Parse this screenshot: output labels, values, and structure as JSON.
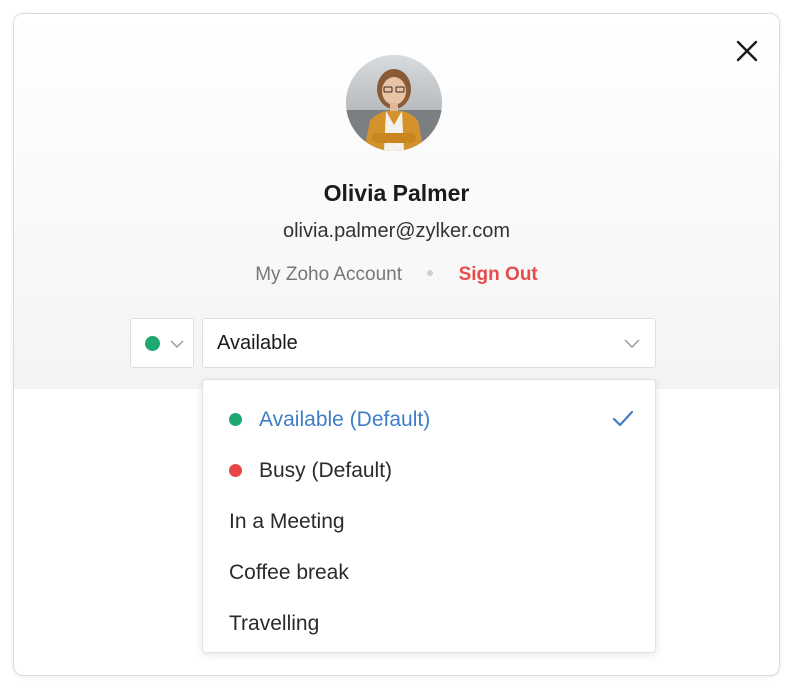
{
  "profile": {
    "name": "Olivia Palmer",
    "email": "olivia.palmer@zylker.com",
    "my_account_label": "My Zoho Account",
    "sign_out_label": "Sign Out"
  },
  "status": {
    "selected_value": "Available",
    "current_dot_color": "#1fa971",
    "options": [
      {
        "label": "Available (Default)",
        "dot_color": "#1fa971",
        "selected": true
      },
      {
        "label": "Busy (Default)",
        "dot_color": "#e84545",
        "selected": false
      },
      {
        "label": "In a Meeting",
        "dot_color": null,
        "selected": false
      },
      {
        "label": "Coffee break",
        "dot_color": null,
        "selected": false
      },
      {
        "label": "Travelling",
        "dot_color": null,
        "selected": false
      }
    ]
  },
  "icons": {
    "close": "close-icon",
    "chevron": "chevron-down-icon",
    "check": "check-icon"
  },
  "colors": {
    "accent_blue": "#3f7dc6",
    "sign_out_red": "#e64c4c",
    "available_green": "#1fa971",
    "busy_red": "#e84545"
  }
}
